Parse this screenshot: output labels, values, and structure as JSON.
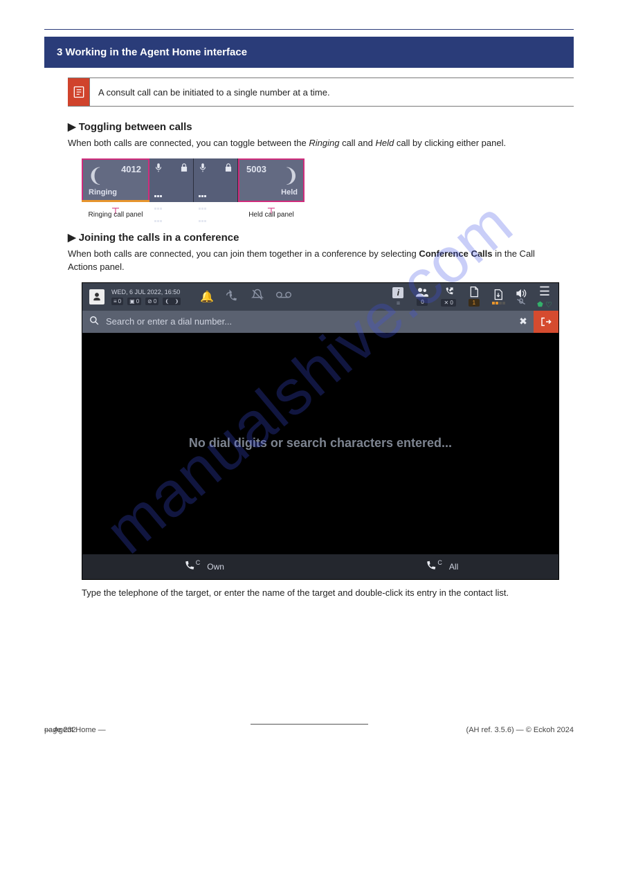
{
  "banner": "3 Working in the Agent Home interface",
  "note": "A consult call can be initiated to a single number at a time.",
  "sections": {
    "toggle": {
      "heading": "▶ Toggling between calls",
      "body_prefix": "When both calls are connected, you can toggle between the ",
      "term1": "Ringing",
      "body_mid": " call and ",
      "term2": "Held",
      "body_suffix": " call by clicking either panel."
    },
    "conference": {
      "heading": "▶ Joining the calls in a conference",
      "body_prefix": "When both calls are connected, you can join them together in a conference by selecting ",
      "body_link": "Conference Calls",
      "body_suffix": " in the Call Actions panel."
    }
  },
  "panels": {
    "ringing": {
      "num": "4012",
      "status": "Ringing"
    },
    "held": {
      "num": "5003",
      "status": "Held"
    },
    "label_ringing": "Ringing call panel",
    "label_held": "Held call panel"
  },
  "app": {
    "datetime": "WED, 6 JUL 2022, 16:50",
    "counters": {
      "a": "0",
      "b": "0",
      "c": "0"
    },
    "right": {
      "contacts": "0",
      "calls": "0",
      "files": "1"
    },
    "search_placeholder": "Search or enter a dial number...",
    "empty_msg": "No dial digits or search characters entered...",
    "bottom": {
      "own": "Own",
      "all": "All"
    }
  },
  "below": "Type the telephone of the target, or enter the name of the target and double-click its entry in the contact list.",
  "footer": {
    "left": "page 232",
    "center": "— Agent Home —",
    "right": "(AH ref. 3.5.6) — © Eckoh 2024"
  }
}
